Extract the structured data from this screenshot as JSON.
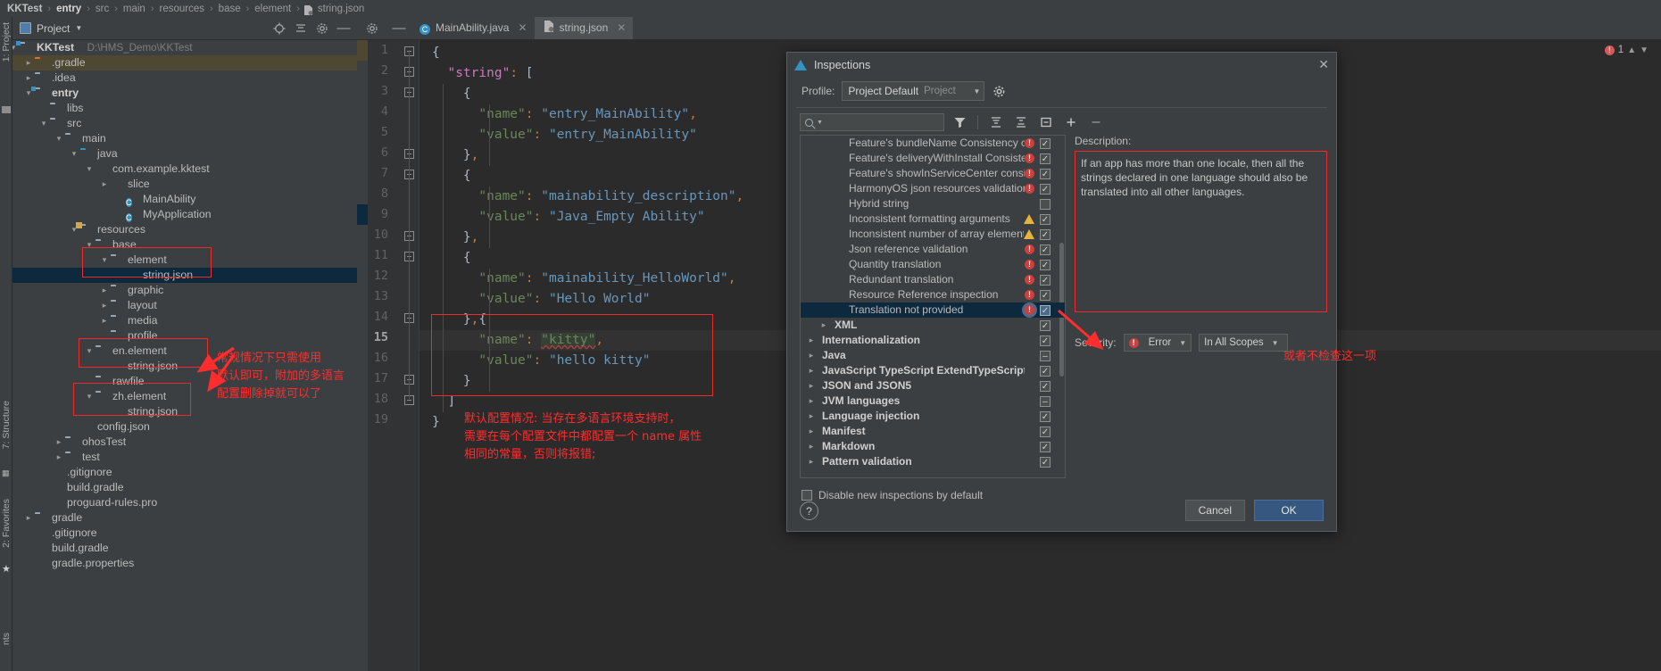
{
  "breadcrumb": {
    "items": [
      "KKTest",
      "entry",
      "src",
      "main",
      "resources",
      "base",
      "element",
      "string.json"
    ]
  },
  "project_panel": {
    "title": "Project",
    "actions": [
      "locate-icon",
      "collapse-all-icon",
      "settings-icon",
      "hide-icon"
    ],
    "tree": [
      {
        "label": "KKTest",
        "path": "D:\\HMS_Demo\\KKTest",
        "depth": 0,
        "arrow": "v",
        "icon": "module-folder",
        "bold": true
      },
      {
        "label": ".gradle",
        "depth": 1,
        "arrow": ">",
        "icon": "folder-orange",
        "highlight": true
      },
      {
        "label": ".idea",
        "depth": 1,
        "arrow": ">",
        "icon": "folder"
      },
      {
        "label": "entry",
        "depth": 1,
        "arrow": "v",
        "icon": "module-folder",
        "bold": true
      },
      {
        "label": "libs",
        "depth": 2,
        "arrow": "",
        "icon": "folder"
      },
      {
        "label": "src",
        "depth": 2,
        "arrow": "v",
        "icon": "folder"
      },
      {
        "label": "main",
        "depth": 3,
        "arrow": "v",
        "icon": "folder"
      },
      {
        "label": "java",
        "depth": 4,
        "arrow": "v",
        "icon": "folder-blue"
      },
      {
        "label": "com.example.kktest",
        "depth": 5,
        "arrow": "v",
        "icon": "package"
      },
      {
        "label": "slice",
        "depth": 6,
        "arrow": ">",
        "icon": "package"
      },
      {
        "label": "MainAbility",
        "depth": 7,
        "arrow": "",
        "icon": "class"
      },
      {
        "label": "MyApplication",
        "depth": 7,
        "arrow": "",
        "icon": "class"
      },
      {
        "label": "resources",
        "depth": 4,
        "arrow": "v",
        "icon": "res-folder"
      },
      {
        "label": "base",
        "depth": 5,
        "arrow": "v",
        "icon": "folder"
      },
      {
        "label": "element",
        "depth": 6,
        "arrow": "v",
        "icon": "folder"
      },
      {
        "label": "string.json",
        "depth": 7,
        "arrow": "",
        "icon": "json",
        "selected": true
      },
      {
        "label": "graphic",
        "depth": 6,
        "arrow": ">",
        "icon": "folder"
      },
      {
        "label": "layout",
        "depth": 6,
        "arrow": ">",
        "icon": "folder"
      },
      {
        "label": "media",
        "depth": 6,
        "arrow": ">",
        "icon": "folder"
      },
      {
        "label": "profile",
        "depth": 6,
        "arrow": "",
        "icon": "folder"
      },
      {
        "label": "en.element",
        "depth": 5,
        "arrow": "v",
        "icon": "folder"
      },
      {
        "label": "string.json",
        "depth": 6,
        "arrow": "",
        "icon": "json"
      },
      {
        "label": "rawfile",
        "depth": 5,
        "arrow": "",
        "icon": "folder"
      },
      {
        "label": "zh.element",
        "depth": 5,
        "arrow": "v",
        "icon": "folder"
      },
      {
        "label": "string.json",
        "depth": 6,
        "arrow": "",
        "icon": "json"
      },
      {
        "label": "config.json",
        "depth": 4,
        "arrow": "",
        "icon": "json"
      },
      {
        "label": "ohosTest",
        "depth": 3,
        "arrow": ">",
        "icon": "folder"
      },
      {
        "label": "test",
        "depth": 3,
        "arrow": ">",
        "icon": "folder"
      },
      {
        "label": ".gitignore",
        "depth": 2,
        "arrow": "",
        "icon": "file-ignore"
      },
      {
        "label": "build.gradle",
        "depth": 2,
        "arrow": "",
        "icon": "gradle"
      },
      {
        "label": "proguard-rules.pro",
        "depth": 2,
        "arrow": "",
        "icon": "file"
      },
      {
        "label": "gradle",
        "depth": 1,
        "arrow": ">",
        "icon": "folder"
      },
      {
        "label": ".gitignore",
        "depth": 1,
        "arrow": "",
        "icon": "file-ignore"
      },
      {
        "label": "build.gradle",
        "depth": 1,
        "arrow": "",
        "icon": "gradle"
      },
      {
        "label": "gradle.properties",
        "depth": 1,
        "arrow": "",
        "icon": "properties"
      }
    ]
  },
  "tool_windows": {
    "left_top": "1: Project",
    "left_structure": "7: Structure",
    "left_favorites": "2: Favorites",
    "left_bottom": "nts"
  },
  "editor": {
    "tabs": [
      {
        "label": "MainAbility.java",
        "icon": "class-icon",
        "active": false
      },
      {
        "label": "string.json",
        "icon": "json-icon",
        "active": true
      }
    ],
    "error_count": "1",
    "lines": [
      {
        "n": "1",
        "text": "{"
      },
      {
        "n": "2",
        "text": "  \"string\": ["
      },
      {
        "n": "3",
        "text": "    {"
      },
      {
        "n": "4",
        "text": "      \"name\": \"entry_MainAbility\","
      },
      {
        "n": "5",
        "text": "      \"value\": \"entry_MainAbility\""
      },
      {
        "n": "6",
        "text": "    },"
      },
      {
        "n": "7",
        "text": "    {"
      },
      {
        "n": "8",
        "text": "      \"name\": \"mainability_description\","
      },
      {
        "n": "9",
        "text": "      \"value\": \"Java_Empty Ability\""
      },
      {
        "n": "10",
        "text": "    },"
      },
      {
        "n": "11",
        "text": "    {"
      },
      {
        "n": "12",
        "text": "      \"name\": \"mainability_HelloWorld\","
      },
      {
        "n": "13",
        "text": "      \"value\": \"Hello World\""
      },
      {
        "n": "14",
        "text": "    },{"
      },
      {
        "n": "15",
        "text": "      \"name\": \"kitty\","
      },
      {
        "n": "16",
        "text": "      \"value\": \"hello kitty\""
      },
      {
        "n": "17",
        "text": "    }"
      },
      {
        "n": "18",
        "text": "  ]"
      },
      {
        "n": "19",
        "text": "}"
      }
    ]
  },
  "annotations": {
    "tree_note": "常规情况下只需使用\n默认即可，附加的多语言\n配置删除掉就可以了",
    "editor_note": "默认配置情况: 当存在多语言环境支持时，\n需要在每个配置文件中都配置一个 name 属性\n相同的常量，否则将报错;",
    "dialog_note": "或者不检查这一项"
  },
  "dialog": {
    "title": "Inspections",
    "close_label": "✕",
    "profile_label": "Profile:",
    "profile_value": "Project Default",
    "profile_scope": "Project",
    "search_placeholder": "",
    "toolbar_icons": [
      "filter-icon",
      "expand-all-icon",
      "collapse-all-icon",
      "group-icon",
      "add-icon",
      "remove-icon"
    ],
    "inspections": [
      {
        "label": "Feature's bundleName Consistency check",
        "severity": "error",
        "state": "on",
        "type": "leaf"
      },
      {
        "label": "Feature's deliveryWithInstall Consistency c",
        "severity": "error",
        "state": "on",
        "type": "leaf"
      },
      {
        "label": "Feature's showInServiceCenter consistenc",
        "severity": "error",
        "state": "on",
        "type": "leaf"
      },
      {
        "label": "HarmonyOS json resources validation",
        "severity": "error",
        "state": "on",
        "type": "leaf"
      },
      {
        "label": "Hybrid string",
        "severity": "none",
        "state": "off",
        "type": "leaf"
      },
      {
        "label": "Inconsistent formatting arguments",
        "severity": "warning",
        "state": "on",
        "type": "leaf"
      },
      {
        "label": "Inconsistent number of array elements",
        "severity": "warning",
        "state": "on",
        "type": "leaf"
      },
      {
        "label": "Json reference validation",
        "severity": "error",
        "state": "on",
        "type": "leaf"
      },
      {
        "label": "Quantity translation",
        "severity": "error",
        "state": "on",
        "type": "leaf"
      },
      {
        "label": "Redundant translation",
        "severity": "error",
        "state": "on",
        "type": "leaf"
      },
      {
        "label": "Resource Reference inspection",
        "severity": "error",
        "state": "on",
        "type": "leaf"
      },
      {
        "label": "Translation not provided",
        "severity": "error",
        "state": "on",
        "type": "leaf",
        "selected": true
      },
      {
        "label": "XML",
        "severity": "none",
        "state": "on",
        "type": "subgroup"
      },
      {
        "label": "Internationalization",
        "severity": "none",
        "state": "on",
        "type": "group"
      },
      {
        "label": "Java",
        "severity": "none",
        "state": "tri",
        "type": "group"
      },
      {
        "label": "JavaScript TypeScript ExtendTypeScript",
        "severity": "none",
        "state": "on",
        "type": "group"
      },
      {
        "label": "JSON and JSON5",
        "severity": "none",
        "state": "on",
        "type": "group"
      },
      {
        "label": "JVM languages",
        "severity": "none",
        "state": "tri",
        "type": "group"
      },
      {
        "label": "Language injection",
        "severity": "none",
        "state": "on",
        "type": "group"
      },
      {
        "label": "Manifest",
        "severity": "none",
        "state": "on",
        "type": "group"
      },
      {
        "label": "Markdown",
        "severity": "none",
        "state": "on",
        "type": "group"
      },
      {
        "label": "Pattern validation",
        "severity": "none",
        "state": "on",
        "type": "group"
      }
    ],
    "description_label": "Description:",
    "description_text": "If an app has more than one locale, then all the strings declared in one language should also be translated into all other languages.",
    "severity_label": "Severity:",
    "severity_value": "Error",
    "scope_value": "In All Scopes",
    "disable_label": "Disable new inspections by default",
    "disable_checked": false,
    "help_label": "?",
    "cancel_label": "Cancel",
    "ok_label": "OK"
  },
  "colors": {
    "accent_blue": "#365880",
    "selection": "#0d293e",
    "error_red": "#c9413f",
    "warn_yellow": "#e8b33a",
    "annotation_red": "#ff2d2d",
    "editor_bg": "#2b2b2b",
    "panel_bg": "#3c3f41"
  }
}
